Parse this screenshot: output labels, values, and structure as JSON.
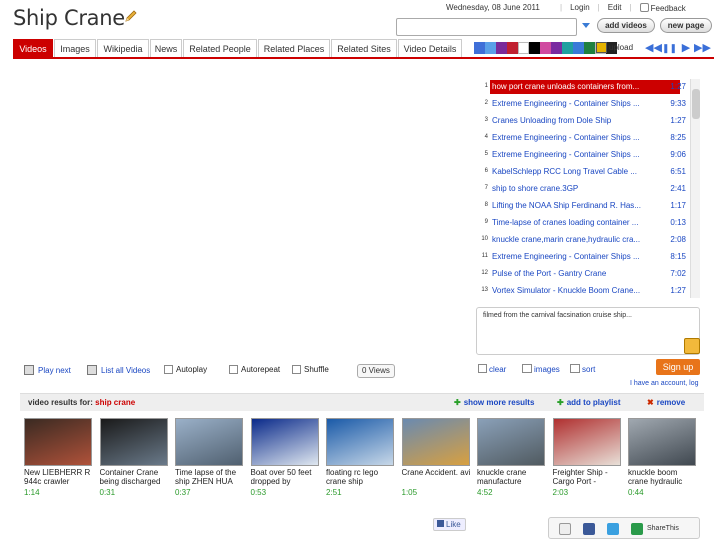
{
  "app": {
    "title": "Ship Crane"
  },
  "header": {
    "date": "Wednesday, 08 June 2011",
    "login": "Login",
    "edit": "Edit",
    "feedback": "Feedback",
    "add_videos": "add videos",
    "new_page": "new page",
    "search_value": ""
  },
  "tabs": [
    "Videos",
    "Images",
    "Wikipedia",
    "News",
    "Related People",
    "Related Places",
    "Related Sites",
    "Video Details"
  ],
  "active_tab": "Videos",
  "swatch_colors": [
    "#3f6fd8",
    "#5aa0e8",
    "#7a2a9a",
    "#c02030",
    "#ffffff",
    "#000000",
    "#d04aa0",
    "#7a2aa0",
    "#20a0a0",
    "#3a7ad8",
    "#208040",
    "#ffffff",
    "#222222"
  ],
  "upload_label": "upload",
  "playlist": [
    {
      "n": "1",
      "title": "how port crane unloads containers from...",
      "dur": "1:27",
      "active": true
    },
    {
      "n": "2",
      "title": "Extreme Engineering - Container Ships ...",
      "dur": "9:33"
    },
    {
      "n": "3",
      "title": "Cranes Unloading from Dole Ship",
      "dur": "1:27"
    },
    {
      "n": "4",
      "title": "Extreme Engineering - Container Ships ...",
      "dur": "8:25"
    },
    {
      "n": "5",
      "title": "Extreme Engineering - Container Ships ...",
      "dur": "9:06"
    },
    {
      "n": "6",
      "title": "KabelSchlepp RCC Long Travel Cable ...",
      "dur": "6:51"
    },
    {
      "n": "7",
      "title": "ship to shore crane.3GP",
      "dur": "2:41"
    },
    {
      "n": "8",
      "title": "Lifting the NOAA Ship Ferdinand R. Has...",
      "dur": "1:17"
    },
    {
      "n": "9",
      "title": "Time-lapse of cranes loading container ...",
      "dur": "0:13"
    },
    {
      "n": "10",
      "title": "knuckle crane,marin crane,hydraulic cra...",
      "dur": "2:08"
    },
    {
      "n": "11",
      "title": "Extreme Engineering - Container Ships ...",
      "dur": "8:15"
    },
    {
      "n": "12",
      "title": "Pulse of the Port - Gantry Crane",
      "dur": "7:02"
    },
    {
      "n": "13",
      "title": "Vortex Simulator - Knuckle Boom Crane...",
      "dur": "1:27"
    }
  ],
  "description": "filmed from the carnival facsination cruise ship...",
  "playlist_actions": {
    "clear": "clear",
    "images": "images",
    "sort": "sort"
  },
  "signup": "Sign up",
  "have_account": "I have an account, log",
  "player": {
    "play_next": "Play next",
    "list_all": "List all Videos",
    "autoplay": "Autoplay",
    "autorepeat": "Autorepeat",
    "shuffle": "Shuffle",
    "views": "0 Views"
  },
  "results": {
    "label": "video results for:",
    "query": "ship crane",
    "show_more": "show more results",
    "add_playlist": "add to playlist",
    "remove": "remove",
    "items": [
      {
        "title": "New LIEBHERR R 944c crawler",
        "dur": "1:14",
        "c1": "#3a2a22",
        "c2": "#b0523a"
      },
      {
        "title": "Container Crane being discharged",
        "dur": "0:31",
        "c1": "#1a1a1a",
        "c2": "#6a7a8a"
      },
      {
        "title": "Time lapse of the ship ZHEN HUA",
        "dur": "0:37",
        "c1": "#9ab0c8",
        "c2": "#506070"
      },
      {
        "title": "Boat over 50 feet dropped by",
        "dur": "0:53",
        "c1": "#0a2a8a",
        "c2": "#e0e8f0"
      },
      {
        "title": "floating rc lego crane ship",
        "dur": "2:51",
        "c1": "#1a5aa8",
        "c2": "#c8d8e8"
      },
      {
        "title": "Crane Accident. avi",
        "dur": "1:05",
        "c1": "#6a8ab0",
        "c2": "#d8a040"
      },
      {
        "title": "knuckle crane manufacture",
        "dur": "4:52",
        "c1": "#8aa0b8",
        "c2": "#505a60"
      },
      {
        "title": "Freighter Ship - Cargo Port -",
        "dur": "2:03",
        "c1": "#b03030",
        "c2": "#e8e0d8"
      },
      {
        "title": "knuckle boom crane hydraulic",
        "dur": "0:44",
        "c1": "#a0a8b0",
        "c2": "#404850"
      }
    ]
  },
  "like": "Like",
  "share": "ShareThis"
}
